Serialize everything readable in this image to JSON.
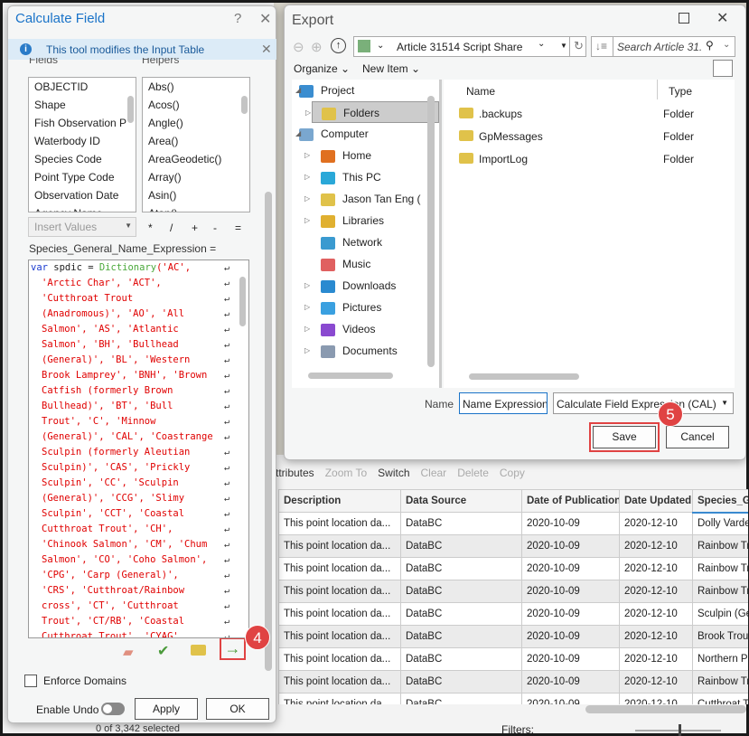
{
  "calc": {
    "title": "Calculate Field",
    "help": "?",
    "info": "This tool modifies the Input Table",
    "fields_label": "Fields",
    "helpers_label": "Helpers",
    "fields": [
      "OBJECTID",
      "Shape",
      "Fish Observation P",
      "Waterbody ID",
      "Species Code",
      "Point Type Code",
      "Observation Date",
      "Agency Name"
    ],
    "helpers": [
      "Abs()",
      "Acos()",
      "Angle()",
      "Area()",
      "AreaGeodetic()",
      "Array()",
      "Asin()",
      "Atan()"
    ],
    "insert_values": "Insert Values",
    "operators": [
      "*",
      "/",
      "+",
      "-",
      "="
    ],
    "expression_label": "Species_General_Name_Expression =",
    "code_first": {
      "kw": "var",
      "var": " spdic = ",
      "fn": "Dictionary",
      "rest": "('AC',"
    },
    "code": [
      "'Arctic Char', 'ACT',",
      "'Cutthroat Trout",
      "(Anadromous)', 'AO', 'All",
      "Salmon', 'AS', 'Atlantic",
      "Salmon', 'BH', 'Bullhead",
      "(General)', 'BL', 'Western",
      "Brook Lamprey', 'BNH', 'Brown",
      "Catfish (formerly Brown",
      "Bullhead)', 'BT', 'Bull",
      "Trout', 'C', 'Minnow",
      "(General)', 'CAL', 'Coastrange",
      "Sculpin (formerly Aleutian",
      "Sculpin)', 'CAS', 'Prickly",
      "Sculpin', 'CC', 'Sculpin",
      "(General)', 'CCG', 'Slimy",
      "Sculpin', 'CCT', 'Coastal",
      "Cutthroat Trout', 'CH',",
      "'Chinook Salmon', 'CM', 'Chum",
      "Salmon', 'CO', 'Coho Salmon',",
      "'CPG', 'Carp (General)',",
      "'CRS', 'Cutthroat/Rainbow",
      "cross', 'CT', 'Cutthroat",
      "Trout', 'CT/RB', 'Coastal",
      "Cutthroat Trout', 'CYAG'"
    ],
    "wrap_glyph": "↵",
    "enforce_domains": "Enforce Domains",
    "enable_undo": "Enable Undo",
    "apply": "Apply",
    "ok": "OK",
    "step_badge": "4",
    "status_partial": "0 of 3,342 selected"
  },
  "export": {
    "title": "Export",
    "location": "Article 31514 Script Share",
    "search_placeholder": "Search Article 31.",
    "organize": "Organize",
    "new_item": "New Item",
    "tree": [
      {
        "label": "Project",
        "color": "#3a8dd0",
        "exp": "◢"
      },
      {
        "label": "Folders",
        "color": "#e0c24a",
        "exp": "▷",
        "selected": true,
        "indent": 1
      },
      {
        "label": "Computer",
        "color": "#7aa7cf",
        "exp": "◢"
      },
      {
        "label": "Home",
        "color": "#e07020",
        "exp": "▷",
        "indent": 1
      },
      {
        "label": "This PC",
        "color": "#2aa8d8",
        "exp": "▷",
        "indent": 1
      },
      {
        "label": "Jason Tan Eng (",
        "color": "#e0c24a",
        "exp": "▷",
        "indent": 1
      },
      {
        "label": "Libraries",
        "color": "#e0b030",
        "exp": "▷",
        "indent": 1
      },
      {
        "label": "Network",
        "color": "#3a9ad0",
        "exp": "",
        "indent": 1
      },
      {
        "label": "Music",
        "color": "#e06060",
        "exp": "",
        "indent": 1
      },
      {
        "label": "Downloads",
        "color": "#2a8ad0",
        "exp": "▷",
        "indent": 1
      },
      {
        "label": "Pictures",
        "color": "#3aa0e0",
        "exp": "▷",
        "indent": 1
      },
      {
        "label": "Videos",
        "color": "#8a4ad0",
        "exp": "▷",
        "indent": 1
      },
      {
        "label": "Documents",
        "color": "#8a9ab0",
        "exp": "▷",
        "indent": 1
      }
    ],
    "col_name": "Name",
    "col_type": "Type",
    "files": [
      {
        "name": ".backups",
        "type": "Folder"
      },
      {
        "name": "GpMessages",
        "type": "Folder"
      },
      {
        "name": "ImportLog",
        "type": "Folder"
      }
    ],
    "name_label": "Name",
    "name_value": "Name Expression",
    "file_type": "Calculate Field Expression (CAL)",
    "save": "Save",
    "cancel": "Cancel",
    "step_badge": "5"
  },
  "table": {
    "toolbar": [
      "ttributes",
      "Zoom To",
      "Switch",
      "Clear",
      "Delete",
      "Copy"
    ],
    "columns": [
      "Description",
      "Data Source",
      "Date of Publication",
      "Date Updated",
      "Species_Ge"
    ],
    "rows": [
      [
        "This point location da...",
        "DataBC",
        "2020-10-09",
        "2020-12-10",
        "Dolly Varde"
      ],
      [
        "This point location da...",
        "DataBC",
        "2020-10-09",
        "2020-12-10",
        "Rainbow Tr"
      ],
      [
        "This point location da...",
        "DataBC",
        "2020-10-09",
        "2020-12-10",
        "Rainbow Tr"
      ],
      [
        "This point location da...",
        "DataBC",
        "2020-10-09",
        "2020-12-10",
        "Rainbow Tr"
      ],
      [
        "This point location da...",
        "DataBC",
        "2020-10-09",
        "2020-12-10",
        "Sculpin (Ge"
      ],
      [
        "This point location da...",
        "DataBC",
        "2020-10-09",
        "2020-12-10",
        "Brook Trou"
      ],
      [
        "This point location da...",
        "DataBC",
        "2020-10-09",
        "2020-12-10",
        "Northern P"
      ],
      [
        "This point location da...",
        "DataBC",
        "2020-10-09",
        "2020-12-10",
        "Rainbow Tr"
      ],
      [
        "This point location da...",
        "DataBC",
        "2020-10-09",
        "2020-12-10",
        "Cutthroat T"
      ]
    ],
    "filters_label": "Filters:"
  },
  "colors": {
    "accent": "#1a73c8",
    "badge": "#e04343",
    "highlight": "#e04343",
    "code_string": "#e00000"
  }
}
